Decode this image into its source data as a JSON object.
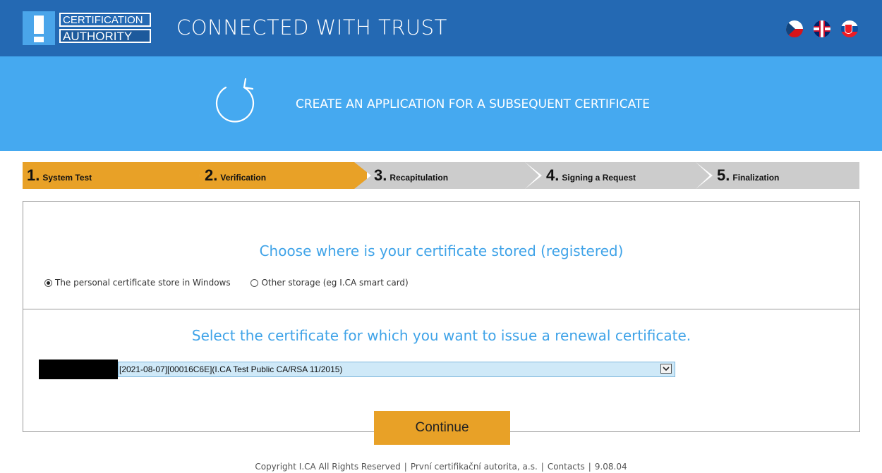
{
  "header": {
    "logo": {
      "line1": "CERTIFICATION",
      "line2": "AUTHORITY"
    },
    "title": "CONNECTED WITH TRUST",
    "languages": [
      "czech-flag-icon",
      "uk-flag-icon",
      "slovak-flag-icon"
    ]
  },
  "banner": {
    "icon": "refresh-icon",
    "title": "CREATE AN APPLICATION FOR A SUBSEQUENT CERTIFICATE"
  },
  "steps": [
    {
      "number": "1.",
      "label": "System Test",
      "state": "done"
    },
    {
      "number": "2.",
      "label": "Verification",
      "state": "active"
    },
    {
      "number": "3.",
      "label": "Recapitulation",
      "state": "pending"
    },
    {
      "number": "4.",
      "label": "Signing a Request",
      "state": "pending"
    },
    {
      "number": "5.",
      "label": "Finalization",
      "state": "pending"
    }
  ],
  "storage": {
    "heading": "Choose where is your certificate stored (registered)",
    "options": [
      {
        "label": "The personal certificate store in Windows",
        "selected": true
      },
      {
        "label": "Other storage (eg I.CA smart card)",
        "selected": false
      }
    ]
  },
  "certificate": {
    "heading": "Select the certificate for which you want to issue a renewal certificate.",
    "selected": "[2021-08-07][00016C6E](I.CA Test Public CA/RSA 11/2015)"
  },
  "actions": {
    "continue_label": "Continue"
  },
  "footer": {
    "copyright": "Copyright I.CA All Rights Reserved",
    "company": "První certifikační autorita, a.s.",
    "contacts": "Contacts",
    "version": "9.08.04"
  },
  "colors": {
    "header_bg": "#2469b3",
    "banner_bg": "#45a9f0",
    "step_active": "#e8a127",
    "step_pending": "#cccccc",
    "heading_blue": "#3fa3e8"
  }
}
